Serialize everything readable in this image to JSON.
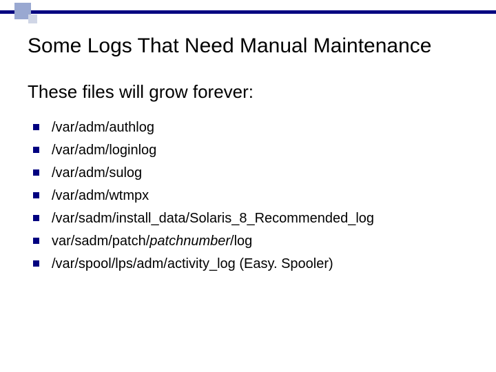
{
  "title": "Some Logs That Need Manual Maintenance",
  "subtitle": "These files will grow forever:",
  "items": {
    "0": "/var/adm/authlog",
    "1": "/var/adm/loginlog",
    "2": "/var/adm/sulog",
    "3": "/var/adm/wtmpx",
    "4": "/var/sadm/install_data/Solaris_8_Recommended_log",
    "5a": "var/sadm/patch/",
    "5b": "patchnumber",
    "5c": "/log",
    "6": "/var/spool/lps/adm/activity_log (Easy. Spooler)"
  }
}
